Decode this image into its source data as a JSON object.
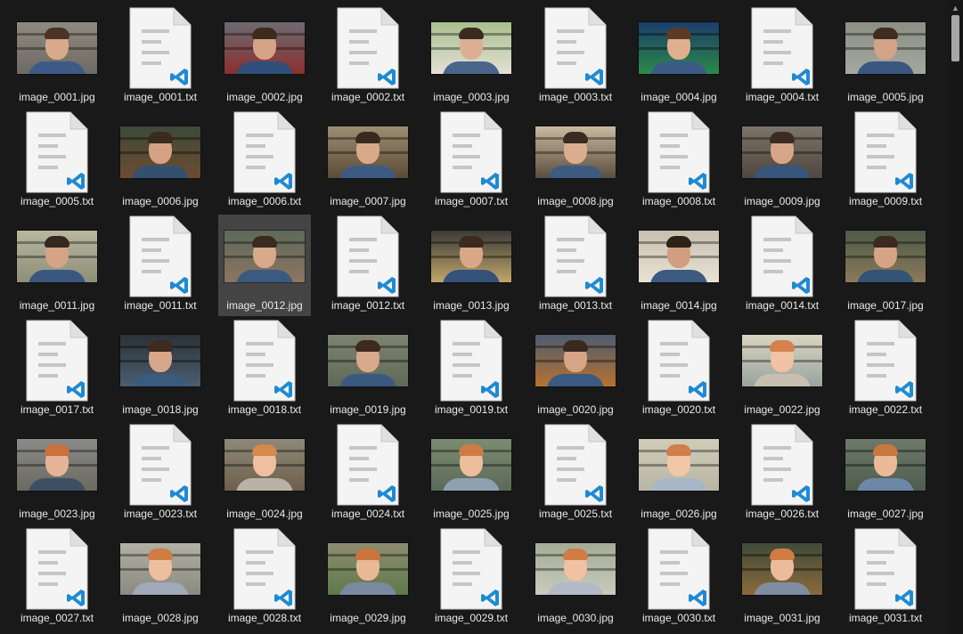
{
  "window": {
    "view": "Large icons"
  },
  "colors": {
    "background": "#191919",
    "selection": "#444444",
    "label_text": "#e8e8e8",
    "vscode_badge": "#1f8ad2"
  },
  "files": [
    {
      "name": "image_0001.jpg",
      "kind": "photo",
      "variant": 0
    },
    {
      "name": "image_0001.txt",
      "kind": "text",
      "icon": "vscode-text-file-icon"
    },
    {
      "name": "image_0002.jpg",
      "kind": "photo",
      "variant": 1
    },
    {
      "name": "image_0002.txt",
      "kind": "text",
      "icon": "vscode-text-file-icon"
    },
    {
      "name": "image_0003.jpg",
      "kind": "photo",
      "variant": 2
    },
    {
      "name": "image_0003.txt",
      "kind": "text",
      "icon": "vscode-text-file-icon"
    },
    {
      "name": "image_0004.jpg",
      "kind": "photo",
      "variant": 3
    },
    {
      "name": "image_0004.txt",
      "kind": "text",
      "icon": "vscode-text-file-icon"
    },
    {
      "name": "image_0005.jpg",
      "kind": "photo",
      "variant": 4
    },
    {
      "name": "image_0005.txt",
      "kind": "text",
      "icon": "vscode-text-file-icon"
    },
    {
      "name": "image_0006.jpg",
      "kind": "photo",
      "variant": 5
    },
    {
      "name": "image_0006.txt",
      "kind": "text",
      "icon": "vscode-text-file-icon"
    },
    {
      "name": "image_0007.jpg",
      "kind": "photo",
      "variant": 6
    },
    {
      "name": "image_0007.txt",
      "kind": "text",
      "icon": "vscode-text-file-icon"
    },
    {
      "name": "image_0008.jpg",
      "kind": "photo",
      "variant": 7
    },
    {
      "name": "image_0008.txt",
      "kind": "text",
      "icon": "vscode-text-file-icon"
    },
    {
      "name": "image_0009.jpg",
      "kind": "photo",
      "variant": 8
    },
    {
      "name": "image_0009.txt",
      "kind": "text",
      "icon": "vscode-text-file-icon"
    },
    {
      "name": "image_0011.jpg",
      "kind": "photo",
      "variant": 9
    },
    {
      "name": "image_0011.txt",
      "kind": "text",
      "icon": "vscode-text-file-icon"
    },
    {
      "name": "image_0012.jpg",
      "kind": "photo",
      "variant": 10,
      "selected": true
    },
    {
      "name": "image_0012.txt",
      "kind": "text",
      "icon": "vscode-text-file-icon"
    },
    {
      "name": "image_0013.jpg",
      "kind": "photo",
      "variant": 11
    },
    {
      "name": "image_0013.txt",
      "kind": "text",
      "icon": "vscode-text-file-icon"
    },
    {
      "name": "image_0014.jpg",
      "kind": "photo",
      "variant": 12
    },
    {
      "name": "image_0014.txt",
      "kind": "text",
      "icon": "vscode-text-file-icon"
    },
    {
      "name": "image_0017.jpg",
      "kind": "photo",
      "variant": 13
    },
    {
      "name": "image_0017.txt",
      "kind": "text",
      "icon": "vscode-text-file-icon"
    },
    {
      "name": "image_0018.jpg",
      "kind": "photo",
      "variant": 14
    },
    {
      "name": "image_0018.txt",
      "kind": "text",
      "icon": "vscode-text-file-icon"
    },
    {
      "name": "image_0019.jpg",
      "kind": "photo",
      "variant": 15
    },
    {
      "name": "image_0019.txt",
      "kind": "text",
      "icon": "vscode-text-file-icon"
    },
    {
      "name": "image_0020.jpg",
      "kind": "photo",
      "variant": 16
    },
    {
      "name": "image_0020.txt",
      "kind": "text",
      "icon": "vscode-text-file-icon"
    },
    {
      "name": "image_0022.jpg",
      "kind": "photo",
      "variant": 17
    },
    {
      "name": "image_0022.txt",
      "kind": "text",
      "icon": "vscode-text-file-icon"
    },
    {
      "name": "image_0023.jpg",
      "kind": "photo",
      "variant": 18
    },
    {
      "name": "image_0023.txt",
      "kind": "text",
      "icon": "vscode-text-file-icon"
    },
    {
      "name": "image_0024.jpg",
      "kind": "photo",
      "variant": 19
    },
    {
      "name": "image_0024.txt",
      "kind": "text",
      "icon": "vscode-text-file-icon"
    },
    {
      "name": "image_0025.jpg",
      "kind": "photo",
      "variant": 20
    },
    {
      "name": "image_0025.txt",
      "kind": "text",
      "icon": "vscode-text-file-icon"
    },
    {
      "name": "image_0026.jpg",
      "kind": "photo",
      "variant": 21
    },
    {
      "name": "image_0026.txt",
      "kind": "text",
      "icon": "vscode-text-file-icon"
    },
    {
      "name": "image_0027.jpg",
      "kind": "photo",
      "variant": 22
    },
    {
      "name": "image_0027.txt",
      "kind": "text",
      "icon": "vscode-text-file-icon"
    },
    {
      "name": "image_0028.jpg",
      "kind": "photo",
      "variant": 23
    },
    {
      "name": "image_0028.txt",
      "kind": "text",
      "icon": "vscode-text-file-icon"
    },
    {
      "name": "image_0029.jpg",
      "kind": "photo",
      "variant": 24
    },
    {
      "name": "image_0029.txt",
      "kind": "text",
      "icon": "vscode-text-file-icon"
    },
    {
      "name": "image_0030.jpg",
      "kind": "photo",
      "variant": 25
    },
    {
      "name": "image_0030.txt",
      "kind": "text",
      "icon": "vscode-text-file-icon"
    },
    {
      "name": "image_0031.jpg",
      "kind": "photo",
      "variant": 26
    },
    {
      "name": "image_0031.txt",
      "kind": "text",
      "icon": "vscode-text-file-icon"
    }
  ],
  "scrollbar": {
    "up_icon": "chevron-up-icon",
    "position": 0.0
  }
}
